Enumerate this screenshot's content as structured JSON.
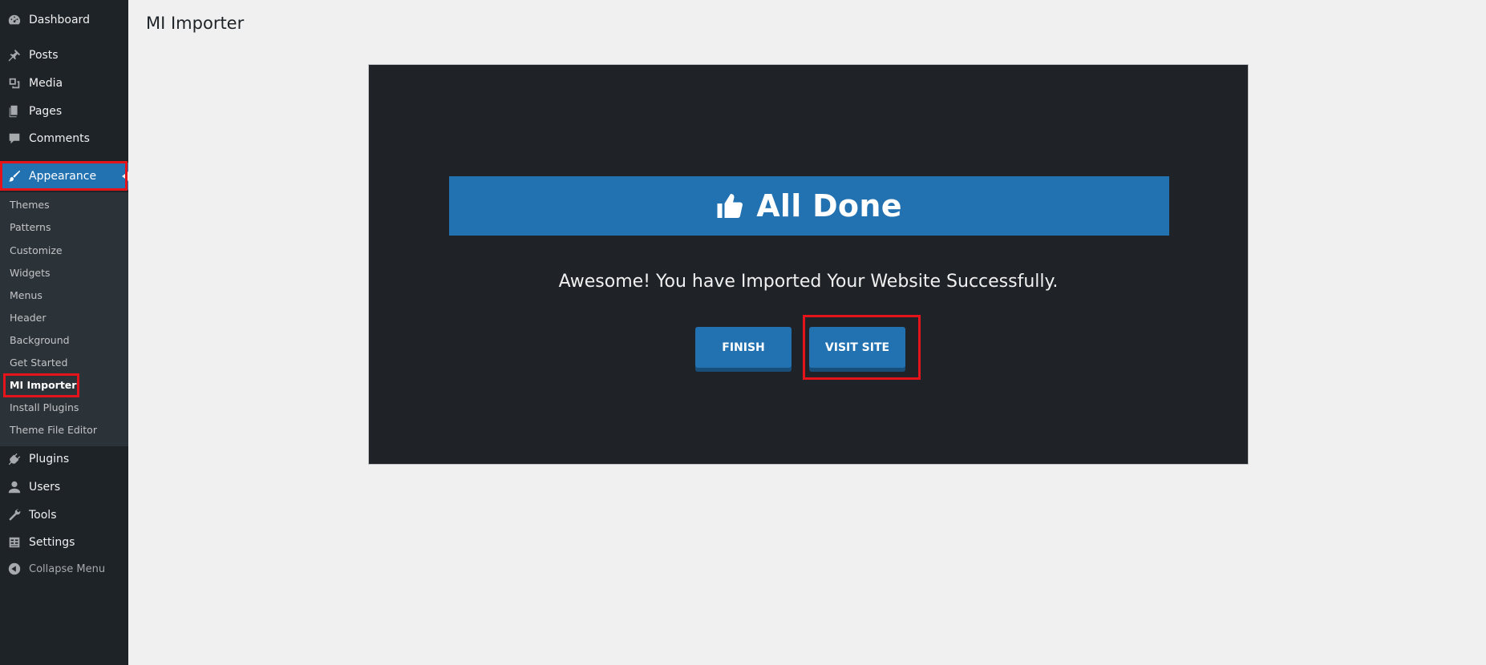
{
  "sidebar": {
    "items": [
      {
        "label": "Dashboard",
        "icon": "dashboard-icon"
      },
      {
        "label": "Posts",
        "icon": "pin-icon"
      },
      {
        "label": "Media",
        "icon": "media-icon"
      },
      {
        "label": "Pages",
        "icon": "pages-icon"
      },
      {
        "label": "Comments",
        "icon": "comment-icon"
      },
      {
        "label": "Appearance",
        "icon": "brush-icon"
      },
      {
        "label": "Plugins",
        "icon": "plugin-icon"
      },
      {
        "label": "Users",
        "icon": "user-icon"
      },
      {
        "label": "Tools",
        "icon": "wrench-icon"
      },
      {
        "label": "Settings",
        "icon": "settings-icon"
      },
      {
        "label": "Collapse Menu",
        "icon": "collapse-icon"
      }
    ],
    "submenu": [
      "Themes",
      "Patterns",
      "Customize",
      "Widgets",
      "Menus",
      "Header",
      "Background",
      "Get Started",
      "MI Importer",
      "Install Plugins",
      "Theme File Editor"
    ]
  },
  "page": {
    "title": "MI Importer",
    "banner_title": "All Done",
    "message": "Awesome! You have Imported Your Website Successfully.",
    "finish_label": "FINISH",
    "visit_label": "VISIT SITE"
  },
  "colors": {
    "sidebar_bg": "#1d2327",
    "submenu_bg": "#2c3338",
    "accent": "#2271b1",
    "panel_bg": "#1f2327",
    "highlight": "#e5141b"
  }
}
